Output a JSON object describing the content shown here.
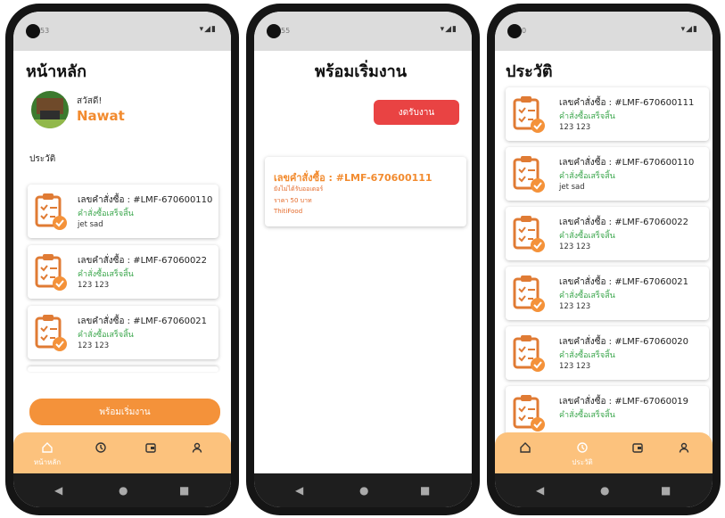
{
  "colors": {
    "accent": "#f4923a",
    "nav_bg": "#fcc27d",
    "success_text": "#3aa64b",
    "danger": "#e94343"
  },
  "system": {
    "time_1": "53",
    "time_2": "55",
    "time_3": "0",
    "signal": "▾◢▮",
    "nav_back": "◀",
    "nav_home": "●",
    "nav_recent": "■"
  },
  "home": {
    "title": "หน้าหลัก",
    "greeting": "สวัสดี!",
    "username": "Nawat",
    "section_title": "ประวัติ",
    "orders": [
      {
        "number": "เลขคำสั่งซื้อ : #LMF-670600110",
        "status": "คำสั่งซื้อเสร็จสิ้น",
        "note": "jet  sad"
      },
      {
        "number": "เลขคำสั่งซื้อ : #LMF-67060022",
        "status": "คำสั่งซื้อเสร็จสิ้น",
        "note": "123  123"
      },
      {
        "number": "เลขคำสั่งซื้อ : #LMF-67060021",
        "status": "คำสั่งซื้อเสร็จสิ้น",
        "note": "123  123"
      }
    ],
    "start_button": "พร้อมเริ่มงาน",
    "nav_home_label": "หน้าหลัก"
  },
  "ready": {
    "title": "พร้อมเริ่มงาน",
    "stop_button": "งดรับงาน",
    "job": {
      "number": "เลขคำสั่งซื้อ : #LMF-670600111",
      "status": "ยังไม่ได้รับออเดอร์",
      "price": "ราคา 50 บาท",
      "shop": "ThitiFood"
    }
  },
  "history": {
    "title": "ประวัติ",
    "orders": [
      {
        "number": "เลขคำสั่งซื้อ : #LMF-670600111",
        "status": "คำสั่งซื้อเสร็จสิ้น",
        "note": "123  123"
      },
      {
        "number": "เลขคำสั่งซื้อ : #LMF-670600110",
        "status": "คำสั่งซื้อเสร็จสิ้น",
        "note": "jet  sad"
      },
      {
        "number": "เลขคำสั่งซื้อ : #LMF-67060022",
        "status": "คำสั่งซื้อเสร็จสิ้น",
        "note": "123  123"
      },
      {
        "number": "เลขคำสั่งซื้อ : #LMF-67060021",
        "status": "คำสั่งซื้อเสร็จสิ้น",
        "note": "123  123"
      },
      {
        "number": "เลขคำสั่งซื้อ : #LMF-67060020",
        "status": "คำสั่งซื้อเสร็จสิ้น",
        "note": "123  123"
      },
      {
        "number": "เลขคำสั่งซื้อ : #LMF-67060019",
        "status": "คำสั่งซื้อเสร็จสิ้น",
        "note": ""
      }
    ],
    "nav_history_label": "ประวัติ"
  }
}
